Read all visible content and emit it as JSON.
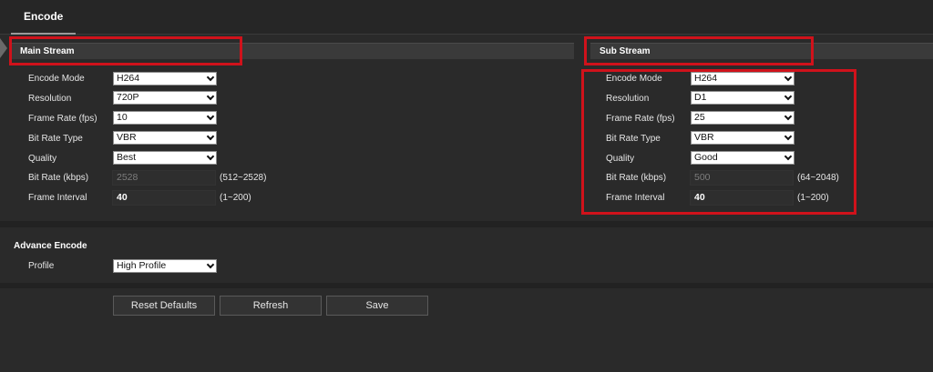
{
  "tabs": {
    "encode": "Encode"
  },
  "main": {
    "title": "Main Stream",
    "labels": {
      "encode_mode": "Encode Mode",
      "resolution": "Resolution",
      "frame_rate": "Frame Rate (fps)",
      "bit_rate_type": "Bit Rate Type",
      "quality": "Quality",
      "bit_rate": "Bit Rate (kbps)",
      "frame_interval": "Frame Interval"
    },
    "values": {
      "encode_mode": "H264",
      "resolution": "720P",
      "frame_rate": "10",
      "bit_rate_type": "VBR",
      "quality": "Best",
      "bit_rate": "2528",
      "frame_interval": "40"
    },
    "ranges": {
      "bit_rate": "(512~2528)",
      "frame_interval": "(1~200)"
    }
  },
  "sub": {
    "title": "Sub Stream",
    "labels": {
      "encode_mode": "Encode Mode",
      "resolution": "Resolution",
      "frame_rate": "Frame Rate (fps)",
      "bit_rate_type": "Bit Rate Type",
      "quality": "Quality",
      "bit_rate": "Bit Rate (kbps)",
      "frame_interval": "Frame Interval"
    },
    "values": {
      "encode_mode": "H264",
      "resolution": "D1",
      "frame_rate": "25",
      "bit_rate_type": "VBR",
      "quality": "Good",
      "bit_rate": "500",
      "frame_interval": "40"
    },
    "ranges": {
      "bit_rate": "(64~2048)",
      "frame_interval": "(1~200)"
    }
  },
  "advance": {
    "title": "Advance Encode",
    "profile_label": "Profile",
    "profile_value": "High Profile"
  },
  "buttons": {
    "reset": "Reset Defaults",
    "refresh": "Refresh",
    "save": "Save"
  },
  "colors": {
    "highlight": "#d0121b",
    "background": "#2a2a2a"
  }
}
